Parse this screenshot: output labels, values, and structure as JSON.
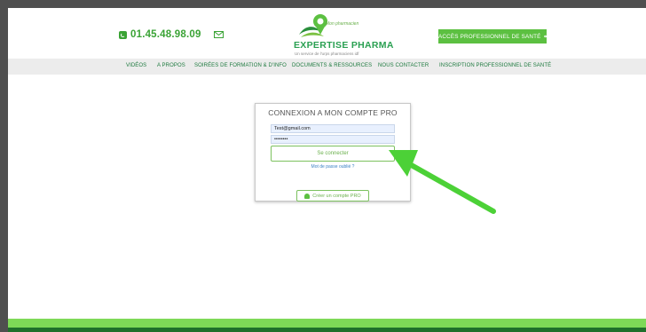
{
  "header": {
    "phone": "01.45.48.98.09",
    "logo_tagline": "Mon pharmacien",
    "logo_title": "EXPERTISE PHARMA",
    "logo_subtitle": "Un service de l'urps pharmaciens idf",
    "pro_button_label": "ACCÈS PROFESSIONNEL DE SANTÉ"
  },
  "nav": {
    "items": [
      "VIDÉOS",
      "A PROPOS",
      "SOIRÉES DE FORMATION & D'INFO",
      "DOCUMENTS & RESSOURCES",
      "NOUS CONTACTER",
      "INSCRIPTION PROFESSIONNEL DE SANTÉ"
    ]
  },
  "login": {
    "title": "CONNEXION A MON COMPTE PRO",
    "email_value": "Test@gmail.com",
    "password_value": "••••••••",
    "connect_label": "Se connecter",
    "forgot_label": "Mot de passe oublié ?",
    "create_label": "Créer un compte PRO"
  },
  "colors": {
    "brand_green": "#5cc041",
    "dark_green": "#1f6f2b",
    "arrow_green": "#4cd137"
  },
  "icons": [
    "phone-icon",
    "mail-icon",
    "location-pin-icon",
    "arrow-right-icon",
    "user-plus-icon"
  ]
}
